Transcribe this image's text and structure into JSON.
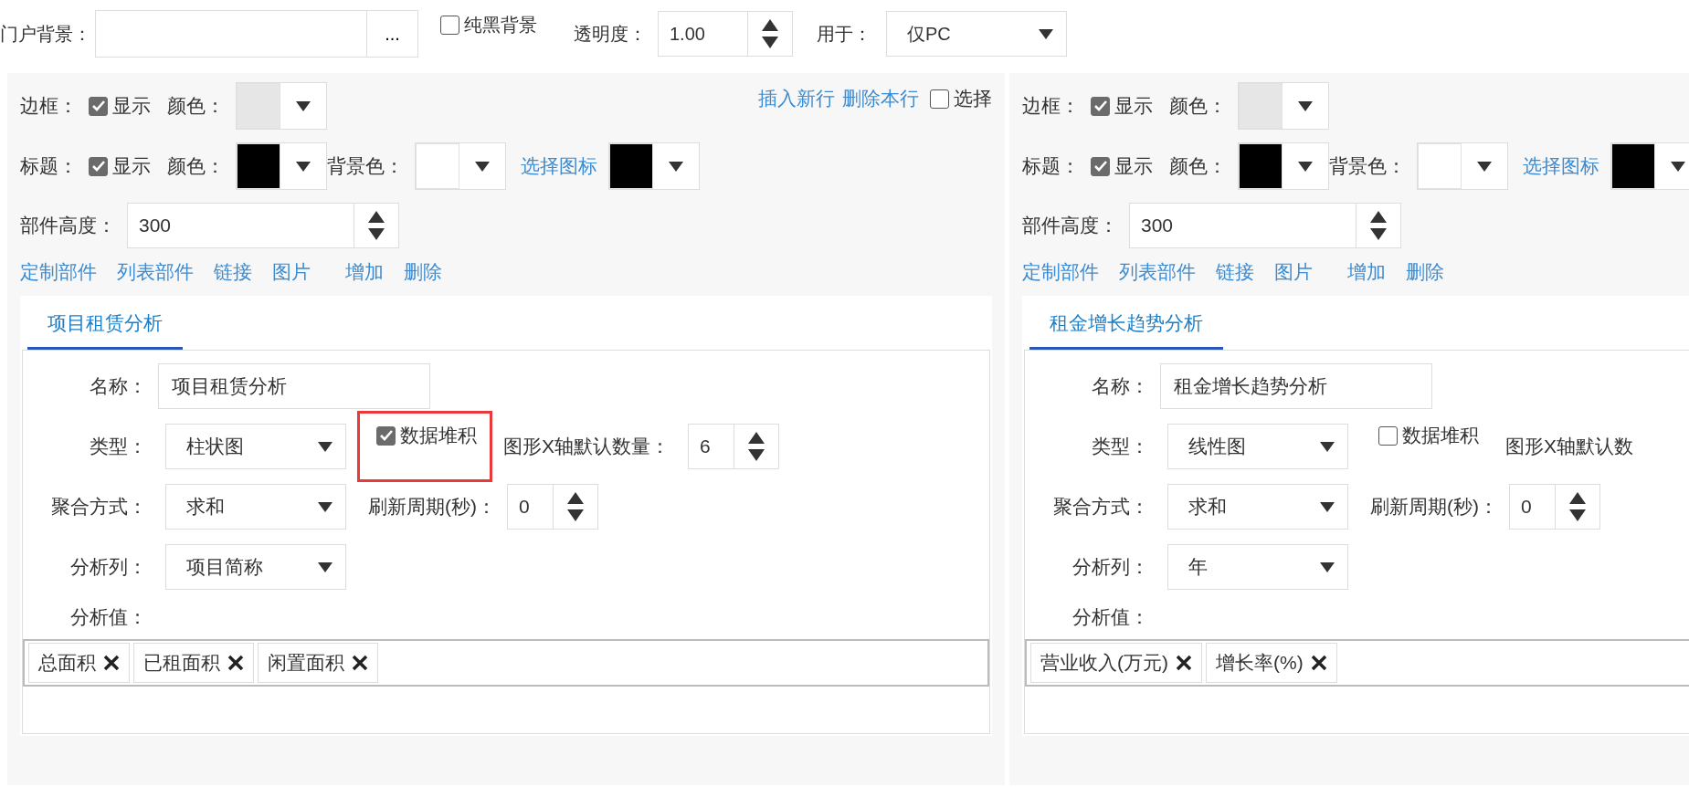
{
  "portal": {
    "background_label": "门户背景：",
    "browse_button": "...",
    "black_background": {
      "label": "纯黑背景",
      "checked": false
    },
    "opacity_label": "透明度：",
    "opacity": "1.00",
    "use_label": "用于：",
    "use": "仅PC"
  },
  "panels": [
    {
      "row_actions": [
        "插入新行",
        "删除本行"
      ],
      "select": {
        "label": "选择",
        "checked": false
      },
      "border": {
        "label": "边框：",
        "show": {
          "label": "显示",
          "checked": true
        },
        "color_label": "颜色：",
        "color": "#e6e6e6"
      },
      "title": {
        "label": "标题：",
        "show": {
          "label": "显示",
          "checked": true
        },
        "color_label": "颜色：",
        "color": "#000000",
        "background": {
          "label": "背景色：",
          "color": "#ffffff"
        },
        "icon": {
          "link": "选择图标",
          "color": "#000000"
        }
      },
      "height": {
        "label": "部件高度：",
        "value": "300"
      },
      "links": [
        "定制部件",
        "列表部件",
        "链接",
        "图片"
      ],
      "actions": [
        "增加",
        "删除"
      ],
      "tabs": [
        {
          "label": "项目租赁分析",
          "selected": true
        }
      ],
      "form": {
        "name_label": "名称：",
        "name": "项目租赁分析",
        "type_label": "类型：",
        "type": "柱状图",
        "stack": {
          "label": "数据堆积",
          "checked": true,
          "highlighted": true
        },
        "x_count_label": "图形X轴默认数量：",
        "x_count": "6",
        "aggregate_label": "聚合方式：",
        "aggregate": "求和",
        "refresh_label": "刷新周期(秒)：",
        "refresh": "0",
        "column_label": "分析列：",
        "column": "项目简称",
        "values_label": "分析值：",
        "values": [
          "总面积",
          "已租面积",
          "闲置面积"
        ]
      }
    },
    {
      "border": {
        "label": "边框：",
        "show": {
          "label": "显示",
          "checked": true
        },
        "color_label": "颜色：",
        "color": "#e6e6e6"
      },
      "title": {
        "label": "标题：",
        "show": {
          "label": "显示",
          "checked": true
        },
        "color_label": "颜色：",
        "color": "#000000",
        "background": {
          "label": "背景色：",
          "color": "#ffffff"
        },
        "icon": {
          "link": "选择图标",
          "color": "#000000"
        }
      },
      "height": {
        "label": "部件高度：",
        "value": "300"
      },
      "links": [
        "定制部件",
        "列表部件",
        "链接",
        "图片"
      ],
      "actions": [
        "增加",
        "删除"
      ],
      "tabs": [
        {
          "label": "租金增长趋势分析",
          "selected": true
        }
      ],
      "form": {
        "name_label": "名称：",
        "name": "租金增长趋势分析",
        "type_label": "类型：",
        "type": "线性图",
        "stack": {
          "label": "数据堆积",
          "checked": false,
          "highlighted": false
        },
        "x_count_label": "图形X轴默认数",
        "aggregate_label": "聚合方式：",
        "aggregate": "求和",
        "refresh_label": "刷新周期(秒)：",
        "refresh": "0",
        "column_label": "分析列：",
        "column": "年",
        "values_label": "分析值：",
        "values": [
          "营业收入(万元)",
          "增长率(%)"
        ]
      }
    }
  ]
}
